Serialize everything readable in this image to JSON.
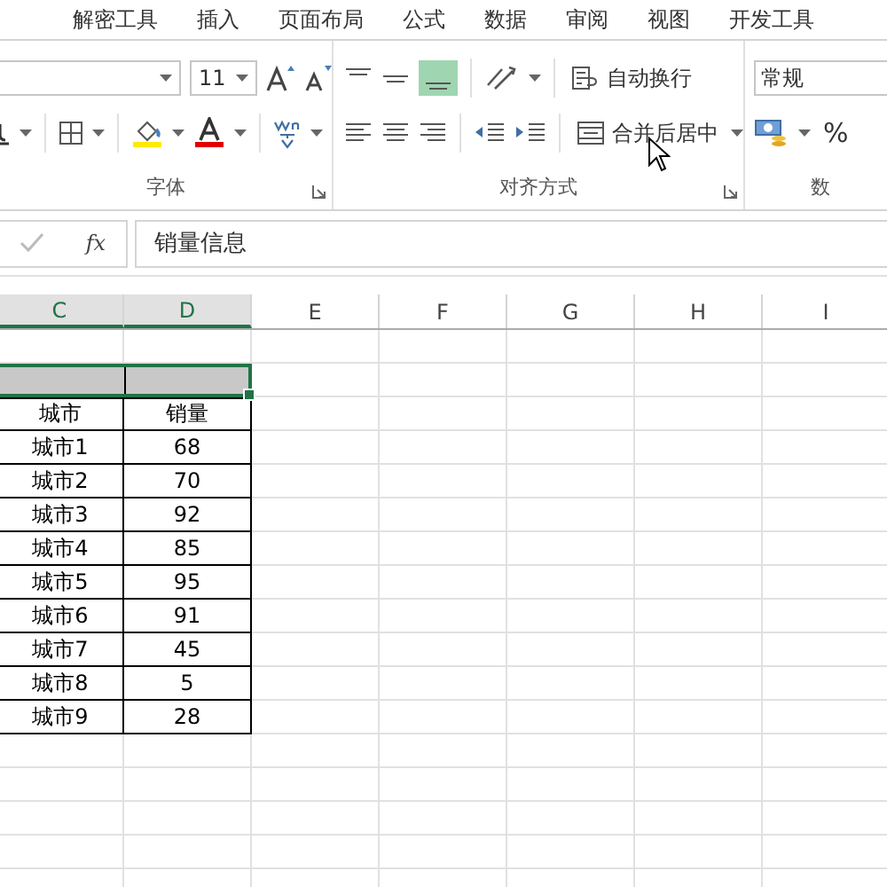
{
  "tabs": [
    {
      "label": "解密工具",
      "selected": false
    },
    {
      "label": "插入",
      "selected": false
    },
    {
      "label": "页面布局",
      "selected": false
    },
    {
      "label": "公式",
      "selected": false
    },
    {
      "label": "数据",
      "selected": false
    },
    {
      "label": "审阅",
      "selected": false
    },
    {
      "label": "视图",
      "selected": false
    },
    {
      "label": "开发工具",
      "selected": false
    }
  ],
  "ribbon": {
    "font_group": {
      "label": "字体",
      "font_size": "11"
    },
    "alignment_group": {
      "label": "对齐方式",
      "wrap_text": "自动换行",
      "merge_center": "合并后居中",
      "bottom_align_selected": true
    },
    "number_group": {
      "label": "数",
      "format": "常规",
      "percent": "%"
    }
  },
  "formula_bar": {
    "fx": "fx",
    "value": "销量信息"
  },
  "columns": [
    {
      "label": "C",
      "selected": true
    },
    {
      "label": "D",
      "selected": true
    },
    {
      "label": "E",
      "selected": false
    },
    {
      "label": "F",
      "selected": false
    },
    {
      "label": "G",
      "selected": false
    },
    {
      "label": "H",
      "selected": false
    },
    {
      "label": "I",
      "selected": false
    }
  ],
  "table": {
    "headers": [
      "城市",
      "销量"
    ],
    "rows": [
      [
        "城市1",
        "68"
      ],
      [
        "城市2",
        "70"
      ],
      [
        "城市3",
        "92"
      ],
      [
        "城市4",
        "85"
      ],
      [
        "城市5",
        "95"
      ],
      [
        "城市6",
        "91"
      ],
      [
        "城市7",
        "45"
      ],
      [
        "城市8",
        "5"
      ],
      [
        "城市9",
        "28"
      ]
    ]
  }
}
